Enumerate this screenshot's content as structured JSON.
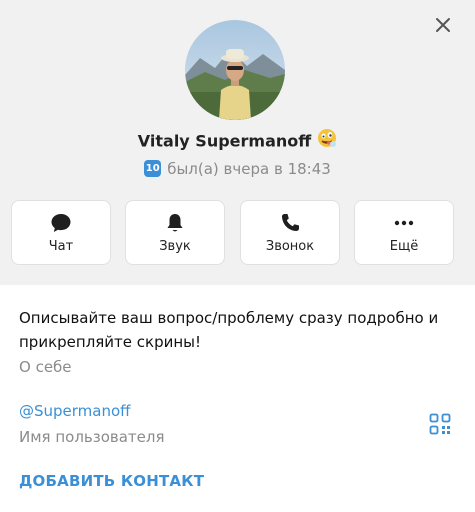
{
  "profile": {
    "name": "Vitaly Supermanoff",
    "emoji_status": "🤪",
    "level_badge": "10",
    "last_seen": "был(а) вчера в 18:43"
  },
  "actions": [
    {
      "label": "Чат",
      "icon": "chat-bubble-icon"
    },
    {
      "label": "Звук",
      "icon": "bell-icon"
    },
    {
      "label": "Звонок",
      "icon": "phone-icon"
    },
    {
      "label": "Ещё",
      "icon": "more-dots-icon"
    }
  ],
  "info": {
    "bio": "Описывайте ваш вопрос/проблему сразу подробно и прикрепляйте скрины!",
    "bio_caption": "О себе",
    "username": "@Supermanoff",
    "username_caption": "Имя пользователя",
    "add_contact": "ДОБАВИТЬ КОНТАКТ"
  },
  "colors": {
    "accent": "#3a8fd6",
    "header_bg": "#f1f1f1",
    "secondary_text": "#8b8b8b"
  }
}
